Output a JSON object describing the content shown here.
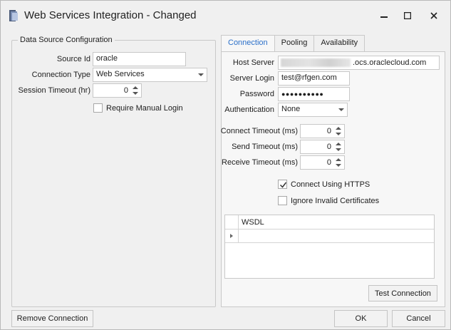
{
  "window": {
    "title": "Web Services Integration - Changed",
    "icon": "app-book-icon",
    "controls": [
      "minimize-icon",
      "maximize-icon",
      "close-icon"
    ]
  },
  "data_source": {
    "legend": "Data Source Configuration",
    "source_id_label": "Source Id",
    "source_id_value": "oracle",
    "connection_type_label": "Connection Type",
    "connection_type_value": "Web Services",
    "session_timeout_label": "Session Timeout (hr)",
    "session_timeout_value": "0",
    "require_manual_login_label": "Require Manual Login",
    "require_manual_login_checked": false
  },
  "tabs": [
    {
      "label": "Connection",
      "active": true
    },
    {
      "label": "Pooling",
      "active": false
    },
    {
      "label": "Availability",
      "active": false
    }
  ],
  "connection": {
    "host_server_label": "Host Server",
    "host_server_value": ".ocs.oraclecloud.com",
    "server_login_label": "Server Login",
    "server_login_value": "test@rfgen.com",
    "password_label": "Password",
    "password_value": "●●●●●●●●●●",
    "authentication_label": "Authentication",
    "authentication_value": "None",
    "connect_timeout_label": "Connect Timeout (ms)",
    "connect_timeout_value": "0",
    "send_timeout_label": "Send Timeout (ms)",
    "send_timeout_value": "0",
    "receive_timeout_label": "Receive Timeout (ms)",
    "receive_timeout_value": "0",
    "connect_https_label": "Connect Using HTTPS",
    "connect_https_checked": true,
    "ignore_certs_label": "Ignore Invalid Certificates",
    "ignore_certs_checked": false,
    "grid_column": "WSDL",
    "test_connection_label": "Test Connection"
  },
  "footer": {
    "remove_label": "Remove Connection",
    "ok_label": "OK",
    "cancel_label": "Cancel"
  },
  "colors": {
    "accent": "#2a6fc9",
    "background": "#f0f0f0",
    "border": "#c9c9c9"
  }
}
